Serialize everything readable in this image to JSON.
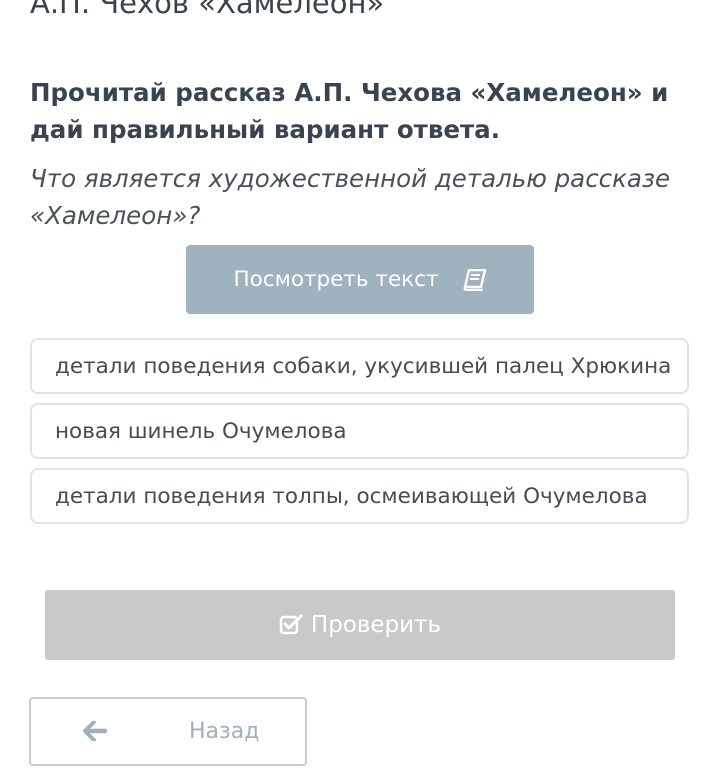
{
  "header": {
    "title": "А.П. Чехов «Хамелеон»"
  },
  "task": {
    "instruction": "Прочитай рассказ А.П. Чехова «Хамелеон» и дай правильный вариант ответа.",
    "question": "Что является художественной деталью рассказе «Хамелеон»?"
  },
  "view_text_button": {
    "label": "Посмотреть текст",
    "icon": "book-icon"
  },
  "options": [
    {
      "label": "детали поведения собаки, укусившей палец Хрюкина"
    },
    {
      "label": "новая шинель Очумелова"
    },
    {
      "label": "детали поведения толпы, осмеивающей Очумелова"
    }
  ],
  "check_button": {
    "label": "Проверить",
    "icon": "check-square-icon",
    "state": "disabled"
  },
  "back_button": {
    "label": "Назад",
    "icon": "arrow-left-icon"
  },
  "colors": {
    "view_button_bg": "#9fb2be",
    "check_button_bg": "#c9c9c9",
    "option_border": "#dfe3e6",
    "back_accent": "#9fb0bc"
  }
}
